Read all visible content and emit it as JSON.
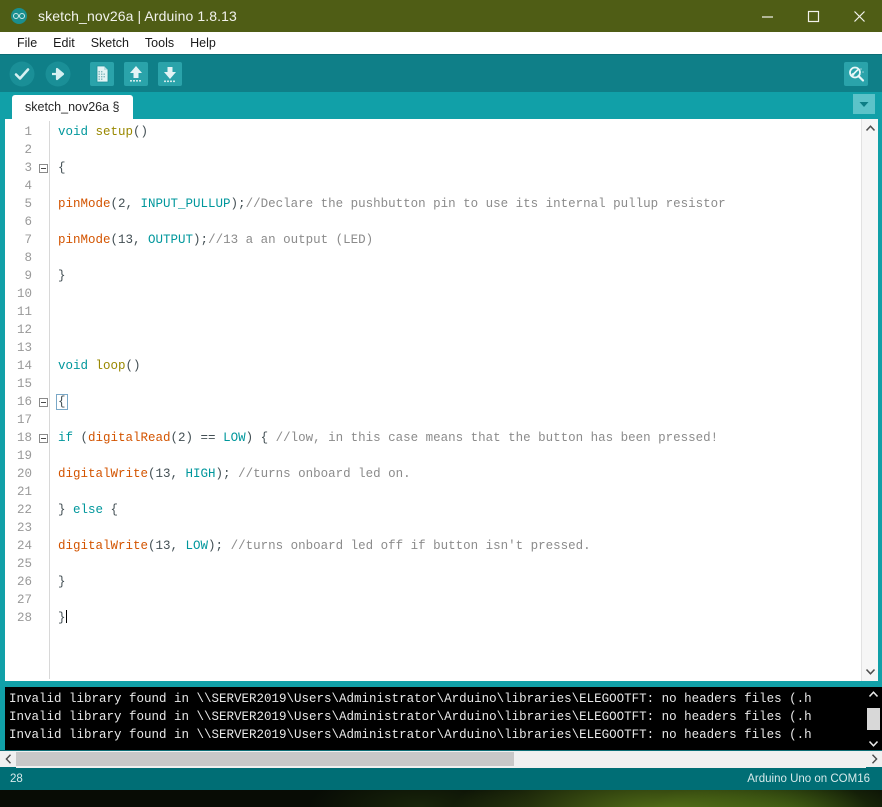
{
  "window": {
    "title": "sketch_nov26a | Arduino 1.8.13",
    "app_icon": "arduino-infinity-icon",
    "controls": {
      "minimize": "minimize-icon",
      "maximize": "maximize-icon",
      "close": "close-icon"
    }
  },
  "menubar": {
    "items": [
      {
        "label": "File"
      },
      {
        "label": "Edit"
      },
      {
        "label": "Sketch"
      },
      {
        "label": "Tools"
      },
      {
        "label": "Help"
      }
    ]
  },
  "toolbar": {
    "verify_label": "Verify",
    "upload_label": "Upload",
    "new_label": "New",
    "open_label": "Open",
    "save_label": "Save",
    "serial_monitor_label": "Serial Monitor"
  },
  "tabs": {
    "active": "sketch_nov26a §",
    "menu_icon": "chevron-down-icon"
  },
  "editor": {
    "lines": [
      {
        "n": "1",
        "fold": false,
        "tokens": [
          {
            "t": "void",
            "c": "kw"
          },
          {
            "t": " ",
            "c": "pln"
          },
          {
            "t": "setup",
            "c": "fn2"
          },
          {
            "t": "()",
            "c": "pln"
          }
        ]
      },
      {
        "n": "2",
        "fold": false,
        "tokens": []
      },
      {
        "n": "3",
        "fold": true,
        "tokens": [
          {
            "t": "{",
            "c": "pln"
          }
        ]
      },
      {
        "n": "4",
        "fold": false,
        "tokens": []
      },
      {
        "n": "5",
        "fold": false,
        "tokens": [
          {
            "t": "pinMode",
            "c": "fn"
          },
          {
            "t": "(2, ",
            "c": "pln"
          },
          {
            "t": "INPUT_PULLUP",
            "c": "con"
          },
          {
            "t": ");",
            "c": "pln"
          },
          {
            "t": "//Declare the pushbutton pin to use its internal pullup resistor",
            "c": "cmt"
          }
        ]
      },
      {
        "n": "6",
        "fold": false,
        "tokens": []
      },
      {
        "n": "7",
        "fold": false,
        "tokens": [
          {
            "t": "pinMode",
            "c": "fn"
          },
          {
            "t": "(13, ",
            "c": "pln"
          },
          {
            "t": "OUTPUT",
            "c": "con"
          },
          {
            "t": ");",
            "c": "pln"
          },
          {
            "t": "//13 a an output (LED)",
            "c": "cmt"
          }
        ]
      },
      {
        "n": "8",
        "fold": false,
        "tokens": []
      },
      {
        "n": "9",
        "fold": false,
        "tokens": [
          {
            "t": "}",
            "c": "pln"
          }
        ]
      },
      {
        "n": "10",
        "fold": false,
        "tokens": []
      },
      {
        "n": "11",
        "fold": false,
        "tokens": []
      },
      {
        "n": "12",
        "fold": false,
        "tokens": []
      },
      {
        "n": "13",
        "fold": false,
        "tokens": []
      },
      {
        "n": "14",
        "fold": false,
        "tokens": [
          {
            "t": "void",
            "c": "kw"
          },
          {
            "t": " ",
            "c": "pln"
          },
          {
            "t": "loop",
            "c": "fn2"
          },
          {
            "t": "()",
            "c": "pln"
          }
        ]
      },
      {
        "n": "15",
        "fold": false,
        "tokens": []
      },
      {
        "n": "16",
        "fold": true,
        "tokens": [
          {
            "t": "{",
            "c": "pln brace-hl"
          }
        ]
      },
      {
        "n": "17",
        "fold": false,
        "tokens": []
      },
      {
        "n": "18",
        "fold": true,
        "tokens": [
          {
            "t": "if",
            "c": "kw"
          },
          {
            "t": " (",
            "c": "pln"
          },
          {
            "t": "digitalRead",
            "c": "fn"
          },
          {
            "t": "(2) == ",
            "c": "pln"
          },
          {
            "t": "LOW",
            "c": "con"
          },
          {
            "t": ") { ",
            "c": "pln"
          },
          {
            "t": "//low, in this case means that the button has been pressed!",
            "c": "cmt"
          }
        ]
      },
      {
        "n": "19",
        "fold": false,
        "tokens": []
      },
      {
        "n": "20",
        "fold": false,
        "tokens": [
          {
            "t": "digitalWrite",
            "c": "fn"
          },
          {
            "t": "(13, ",
            "c": "pln"
          },
          {
            "t": "HIGH",
            "c": "con"
          },
          {
            "t": "); ",
            "c": "pln"
          },
          {
            "t": "//turns onboard led on.",
            "c": "cmt"
          }
        ]
      },
      {
        "n": "21",
        "fold": false,
        "tokens": []
      },
      {
        "n": "22",
        "fold": false,
        "tokens": [
          {
            "t": "} ",
            "c": "pln"
          },
          {
            "t": "else",
            "c": "kw"
          },
          {
            "t": " {",
            "c": "pln"
          }
        ]
      },
      {
        "n": "23",
        "fold": false,
        "tokens": []
      },
      {
        "n": "24",
        "fold": false,
        "tokens": [
          {
            "t": "digitalWrite",
            "c": "fn"
          },
          {
            "t": "(13, ",
            "c": "pln"
          },
          {
            "t": "LOW",
            "c": "con"
          },
          {
            "t": "); ",
            "c": "pln"
          },
          {
            "t": "//turns onboard led off if button isn't pressed.",
            "c": "cmt"
          }
        ]
      },
      {
        "n": "25",
        "fold": false,
        "tokens": []
      },
      {
        "n": "26",
        "fold": false,
        "tokens": [
          {
            "t": "}",
            "c": "pln"
          }
        ]
      },
      {
        "n": "27",
        "fold": false,
        "tokens": []
      },
      {
        "n": "28",
        "fold": false,
        "caret": true,
        "tokens": [
          {
            "t": "}",
            "c": "pln"
          }
        ]
      }
    ],
    "scroll_up_icon": "chevron-up-icon",
    "scroll_down_icon": "chevron-down-icon"
  },
  "console": {
    "lines": [
      "Invalid library found in \\\\SERVER2019\\Users\\Administrator\\Arduino\\libraries\\ELEGOOTFT: no headers files (.h",
      "Invalid library found in \\\\SERVER2019\\Users\\Administrator\\Arduino\\libraries\\ELEGOOTFT: no headers files (.h",
      "Invalid library found in \\\\SERVER2019\\Users\\Administrator\\Arduino\\libraries\\ELEGOOTFT: no headers files (.h"
    ],
    "scroll_up_icon": "chevron-up-icon",
    "scroll_down_icon": "chevron-down-icon"
  },
  "hscrollbar": {
    "left_icon": "chevron-left-icon",
    "right_icon": "chevron-right-icon"
  },
  "statusbar": {
    "line_number": "28",
    "board_info": "Arduino Uno on COM16"
  },
  "colors": {
    "titlebar": "#4f5d15",
    "toolbar": "#0f7f88",
    "tabstrip": "#11a0a8",
    "statusbar": "#006e75",
    "console_bg": "#000000",
    "keyword": "#00979c",
    "function": "#d35400",
    "comment": "#8b8b8b"
  }
}
